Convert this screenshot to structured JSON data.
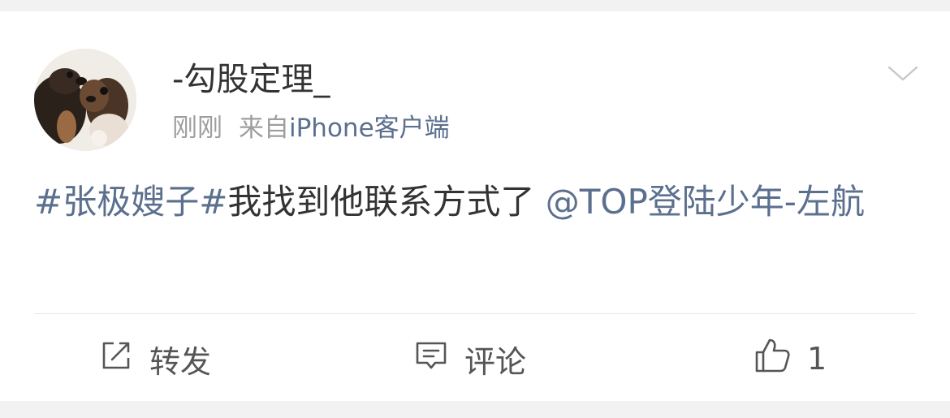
{
  "post": {
    "username": "-勾股定理_",
    "time": "刚刚",
    "source_prefix": "来自",
    "source_client": "iPhone客户端",
    "content": {
      "topic": "#张极嫂子#",
      "text": "我找到他联系方式了",
      "mention": "@TOP登陆少年-左航"
    }
  },
  "actions": {
    "repost_label": "转发",
    "comment_label": "评论",
    "like_count": "1"
  },
  "icons": {
    "menu": "chevron-down-icon",
    "repost": "share-edit-icon",
    "comment": "comment-icon",
    "like": "thumbs-up-icon"
  },
  "colors": {
    "link": "#5b6f8e",
    "text": "#333333",
    "muted": "#9e9e9e",
    "background": "#f2f2f2"
  }
}
